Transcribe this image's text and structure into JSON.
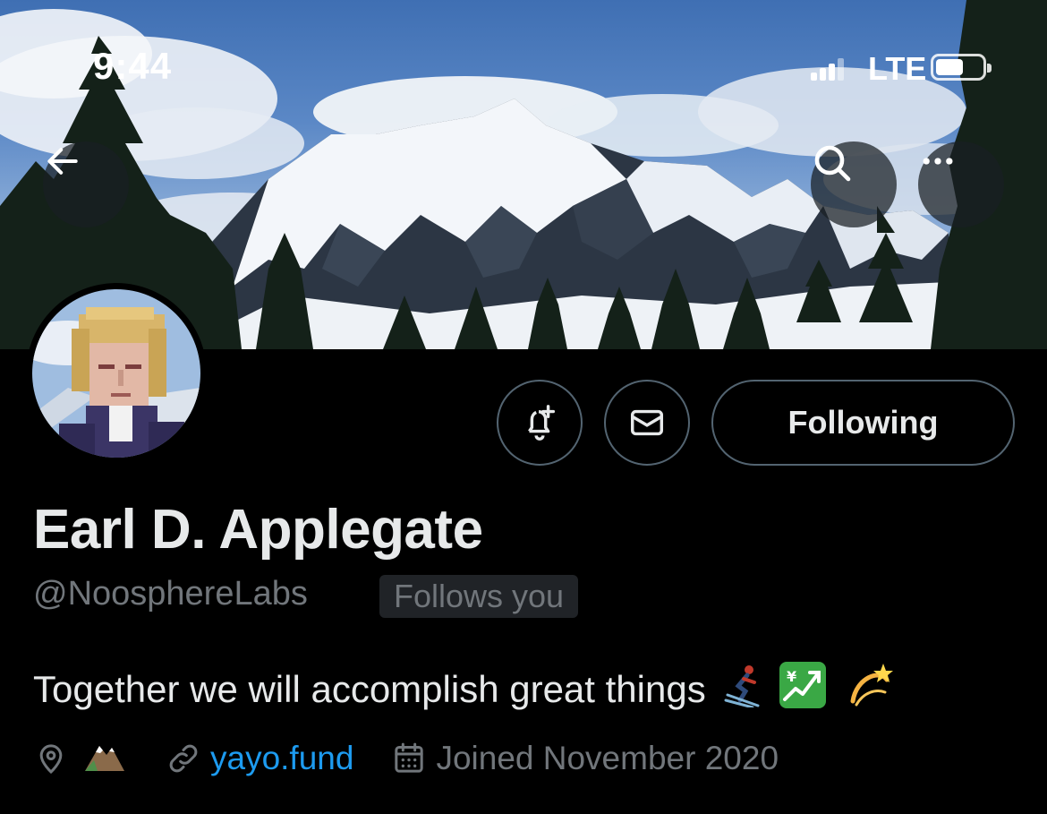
{
  "status_bar": {
    "time": "9:44",
    "network": "LTE"
  },
  "header": {
    "back_icon": "arrow-left-icon",
    "search_icon": "search-icon",
    "more_icon": "more-horizontal-icon"
  },
  "profile": {
    "display_name": "Earl D. Applegate",
    "handle": "@NoosphereLabs",
    "follows_you_label": "Follows you",
    "bio": "Together we will accomplish great things",
    "bio_emojis": [
      "skier",
      "chart-increasing-with-yen",
      "dizzy"
    ],
    "location_icon": "location-pin-icon",
    "location_emoji": "snow-capped-mountain",
    "website": "yayo.fund",
    "joined": "Joined November 2020"
  },
  "actions": {
    "notify_icon": "bell-plus-icon",
    "message_icon": "envelope-icon",
    "following_label": "Following"
  },
  "colors": {
    "accent": "#1d9bf0",
    "muted": "#71767b",
    "text": "#e7e9ea",
    "background": "#000000",
    "border": "#536471"
  }
}
